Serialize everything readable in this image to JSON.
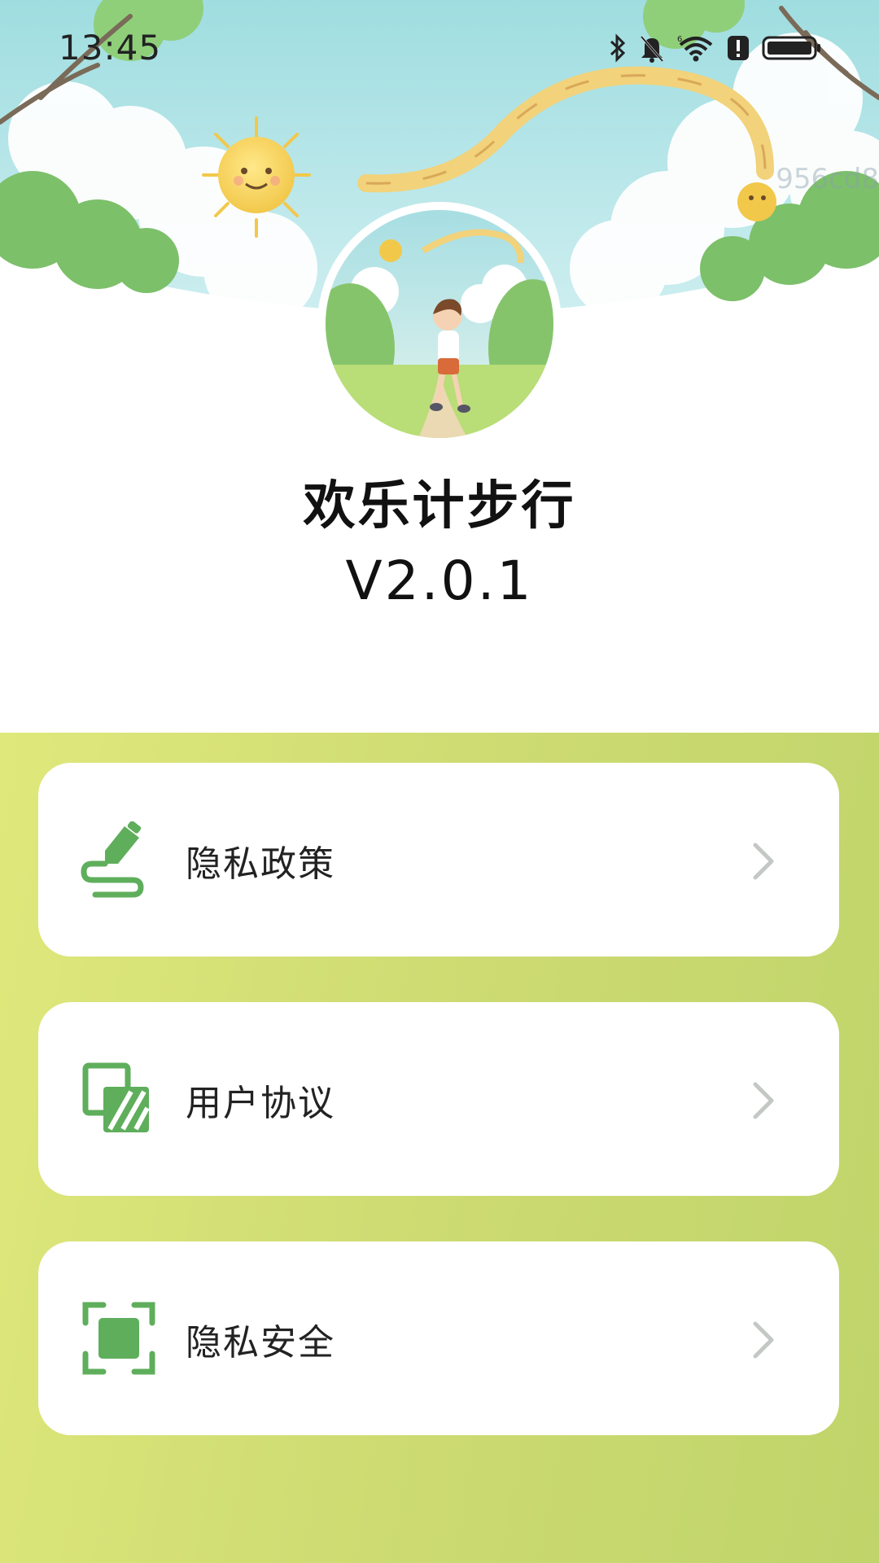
{
  "status_bar": {
    "time": "13:45",
    "icons": [
      "bluetooth-icon",
      "mute-bell-icon",
      "wifi-6-icon",
      "alert-icon",
      "battery-icon"
    ]
  },
  "watermark": "956cd8",
  "app": {
    "name": "欢乐计步行",
    "version": "V2.0.1"
  },
  "menu": [
    {
      "label": "隐私政策",
      "icon": "signature-pen-icon"
    },
    {
      "label": "用户协议",
      "icon": "layered-document-icon"
    },
    {
      "label": "隐私安全",
      "icon": "focus-frame-icon"
    }
  ],
  "colors": {
    "accent_green": "#5fae5c",
    "menu_bg_start": "#dfe87b",
    "menu_bg_end": "#bfd46a",
    "chevron": "#c4c8c4"
  }
}
